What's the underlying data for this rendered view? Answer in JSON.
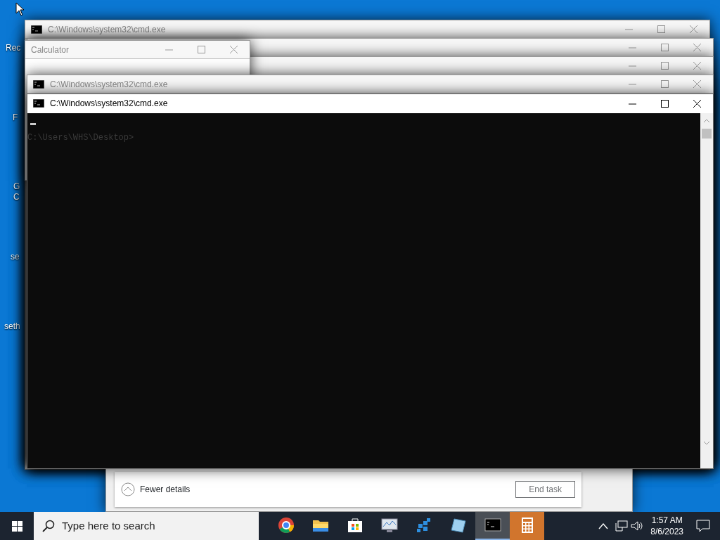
{
  "desktop_icons": [
    {
      "label": "Rec"
    },
    {
      "label": "F"
    },
    {
      "label": "G"
    },
    {
      "label": "C"
    },
    {
      "label": "se"
    },
    {
      "label": "seth"
    }
  ],
  "windows": [
    {
      "kind": "console",
      "title": "C:\\Windows\\system32\\cmd.exe",
      "active": false
    },
    {
      "kind": "console",
      "active": false
    },
    {
      "kind": "console",
      "active": false
    },
    {
      "kind": "calculator",
      "title": "Calculator",
      "active": false
    },
    {
      "kind": "console",
      "title": "C:\\Windows\\system32\\cmd.exe",
      "active": false
    },
    {
      "kind": "task_manager",
      "details_label": "Fewer details",
      "end_button": {
        "label": "End task",
        "disabled": true
      }
    },
    {
      "kind": "console",
      "title": "C:\\Windows\\system32\\cmd.exe",
      "active": true,
      "lines": [
        "C:\\Users\\WHS\\Desktop>"
      ]
    }
  ],
  "taskbar": {
    "search": {
      "placeholder": "Type here to search"
    },
    "apps": [
      {
        "kind": "browser",
        "selected": false,
        "flashing": false
      },
      {
        "kind": "folder",
        "selected": false,
        "flashing": false
      },
      {
        "kind": "store",
        "selected": false,
        "flashing": false
      },
      {
        "kind": "monitor",
        "selected": false,
        "flashing": false
      },
      {
        "kind": "cubes",
        "selected": false,
        "flashing": false
      },
      {
        "kind": "notepad",
        "selected": false,
        "flashing": false
      },
      {
        "kind": "console",
        "selected": true,
        "flashing": false
      },
      {
        "kind": "calculator",
        "selected": false,
        "flashing": true
      }
    ],
    "clock": {
      "time": "1:57 AM",
      "date": "8/6/2023"
    }
  }
}
